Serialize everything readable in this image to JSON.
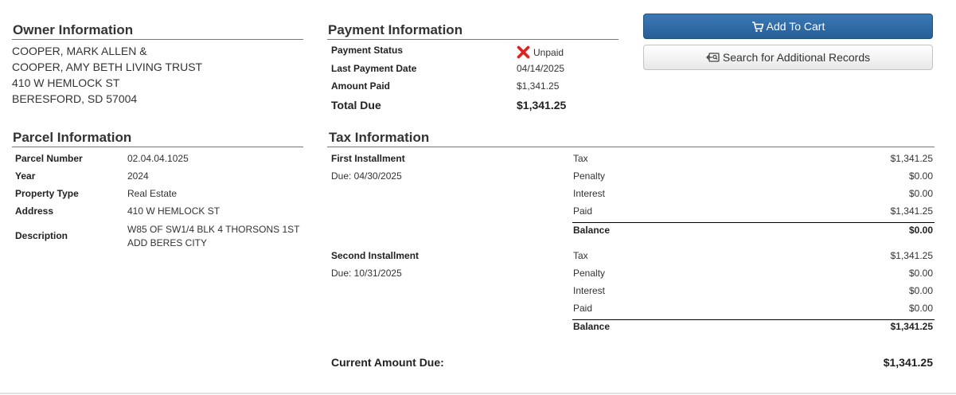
{
  "buttons": {
    "add_to_cart": "Add To Cart",
    "search_records": "Search for Additional Records"
  },
  "owner": {
    "heading": "Owner Information",
    "lines": [
      "COOPER, MARK ALLEN &",
      "COOPER, AMY BETH LIVING TRUST",
      "410 W HEMLOCK ST",
      "BERESFORD, SD  57004"
    ]
  },
  "payment": {
    "heading": "Payment Information",
    "status_label": "Payment Status",
    "status_value": "Unpaid",
    "status_color": "#d9231f",
    "last_date_label": "Last Payment Date",
    "last_date_value": "04/14/2025",
    "amount_paid_label": "Amount Paid",
    "amount_paid_value": "$1,341.25",
    "total_due_label": "Total Due",
    "total_due_value": "$1,341.25"
  },
  "parcel": {
    "heading": "Parcel Information",
    "number_label": "Parcel Number",
    "number_value": "02.04.04.1025",
    "year_label": "Year",
    "year_value": "2024",
    "type_label": "Property Type",
    "type_value": "Real Estate",
    "address_label": "Address",
    "address_value": "410 W HEMLOCK ST",
    "description_label": "Description",
    "description_line1": "W85 OF SW1/4 BLK 4 THORSONS 1ST",
    "description_line2": "ADD BERES CITY"
  },
  "tax": {
    "heading": "Tax Information",
    "first": {
      "title": "First Installment",
      "due": "Due: 04/30/2025",
      "tax_label": "Tax",
      "tax_value": "$1,341.25",
      "penalty_label": "Penalty",
      "penalty_value": "$0.00",
      "interest_label": "Interest",
      "interest_value": "$0.00",
      "paid_label": "Paid",
      "paid_value": "$1,341.25",
      "balance_label": "Balance",
      "balance_value": "$0.00"
    },
    "second": {
      "title": "Second Installment",
      "due": "Due: 10/31/2025",
      "tax_label": "Tax",
      "tax_value": "$1,341.25",
      "penalty_label": "Penalty",
      "penalty_value": "$0.00",
      "interest_label": "Interest",
      "interest_value": "$0.00",
      "paid_label": "Paid",
      "paid_value": "$0.00",
      "balance_label": "Balance",
      "balance_value": "$1,341.25"
    },
    "current_due_label": "Current Amount Due:",
    "current_due_value": "$1,341.25"
  }
}
